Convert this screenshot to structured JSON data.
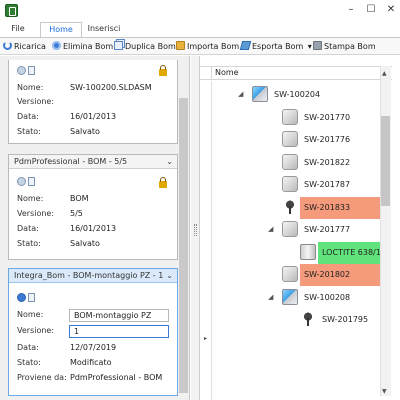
{
  "window": {
    "minimize_glyph": "–",
    "maximize_glyph": "☐",
    "close_glyph": "✕"
  },
  "tabs": [
    {
      "label": "File"
    },
    {
      "label": "Home"
    },
    {
      "label": "Inserisci"
    }
  ],
  "ribbon": {
    "buttons": [
      {
        "label": "Ricarica",
        "icon": "refresh-icon"
      },
      {
        "label": "Elimina Bom",
        "icon": "delete-icon"
      },
      {
        "label": "Duplica Bom",
        "icon": "duplicate-icon"
      },
      {
        "label": "Importa Bom",
        "icon": "import-icon"
      },
      {
        "label": "Esporta Bom",
        "icon": "export-icon",
        "dropdown": "▾"
      },
      {
        "label": "Stampa Bom",
        "icon": "print-icon"
      }
    ]
  },
  "left_panel": {
    "cards": [
      {
        "title": "",
        "rows": [
          {
            "key": "Nome:",
            "value": "SW-100200.SLDASM"
          },
          {
            "key": "Versione:",
            "value": ""
          },
          {
            "key": "Data:",
            "value": "16/01/2013"
          },
          {
            "key": "Stato:",
            "value": "Salvato"
          }
        ]
      },
      {
        "title": "PdmProfessional - BOM - 5/5",
        "chevron": "⌄",
        "rows": [
          {
            "key": "Nome:",
            "value": "BOM"
          },
          {
            "key": "Versione:",
            "value": "5/5"
          },
          {
            "key": "Data:",
            "value": "16/01/2013"
          },
          {
            "key": "Stato:",
            "value": "Salvato"
          }
        ]
      },
      {
        "title": "Integra_Bom - BOM-montaggio  PZ - 1",
        "chevron": "⌄",
        "rows": [
          {
            "key": "Nome:",
            "value": "BOM-montaggio  PZ"
          },
          {
            "key": "Versione:",
            "value": "1"
          },
          {
            "key": "Data:",
            "value": "12/07/2019"
          },
          {
            "key": "Stato:",
            "value": "Modificato"
          },
          {
            "key": "Proviene da:",
            "value": "PdmProfessional - BOM"
          }
        ]
      }
    ]
  },
  "grid": {
    "column": "Nome",
    "gutter_arrow": "▸",
    "nodes": [
      {
        "label": "SW-100204",
        "icon": "assembly-icon",
        "level": 0,
        "toggle": "◢",
        "highlight": ""
      },
      {
        "label": "SW-201770",
        "icon": "part-icon",
        "level": 1,
        "toggle": "",
        "highlight": ""
      },
      {
        "label": "SW-201776",
        "icon": "part-icon",
        "level": 1,
        "toggle": "",
        "highlight": ""
      },
      {
        "label": "SW-201822",
        "icon": "part-icon",
        "level": 1,
        "toggle": "",
        "highlight": ""
      },
      {
        "label": "SW-201787",
        "icon": "part-icon",
        "level": 1,
        "toggle": "",
        "highlight": ""
      },
      {
        "label": "SW-201833",
        "icon": "screw-icon",
        "level": 1,
        "toggle": "",
        "highlight": "#f59a7a"
      },
      {
        "label": "SW-201777",
        "icon": "part-icon",
        "level": 1,
        "toggle": "◢",
        "highlight": ""
      },
      {
        "label": "LOCTITE 638/10",
        "icon": "loctite-icon",
        "level": 2,
        "toggle": "",
        "highlight": "#5fe37a"
      },
      {
        "label": "SW-201802",
        "icon": "part-icon",
        "level": 1,
        "toggle": "",
        "highlight": "#f59a7a"
      },
      {
        "label": "SW-100208",
        "icon": "assembly-icon",
        "level": 1,
        "toggle": "◢",
        "highlight": ""
      },
      {
        "label": "SW-201795",
        "icon": "screw-icon",
        "level": 2,
        "toggle": "",
        "highlight": ""
      }
    ]
  }
}
